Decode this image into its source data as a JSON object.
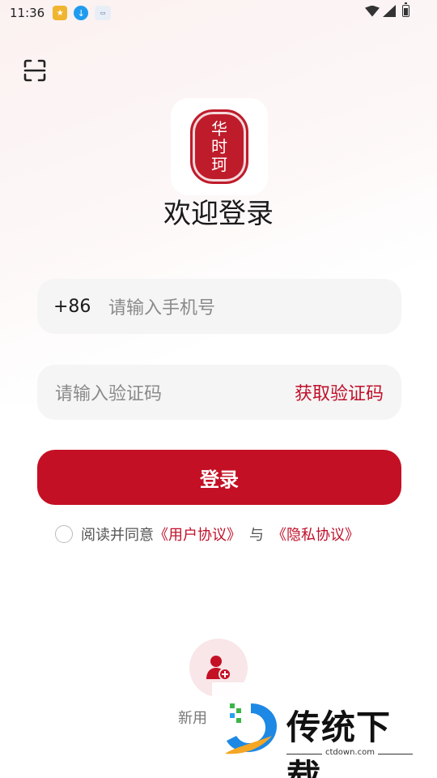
{
  "status_bar": {
    "time": "11:36",
    "app_icons": [
      "app-notification-icon",
      "download-icon",
      "app-notification-icon-2"
    ]
  },
  "header": {
    "scan_icon": "scan-icon"
  },
  "logo": {
    "chars": [
      "华",
      "时",
      "珂"
    ]
  },
  "title": "欢迎登录",
  "phone": {
    "country_code": "+86",
    "placeholder": "请输入手机号"
  },
  "verification": {
    "placeholder": "请输入验证码",
    "get_code_label": "获取验证码"
  },
  "login_label": "登录",
  "agreement": {
    "prefix": "阅读并同意",
    "user_agreement": "《用户协议》",
    "and": "与",
    "privacy_agreement": "《隐私协议》"
  },
  "new_user": {
    "label": "新用"
  },
  "watermark": {
    "text": "传统下载",
    "url": "ctdown.com"
  },
  "colors": {
    "accent": "#c41024",
    "field_bg": "#f5f5f5"
  }
}
